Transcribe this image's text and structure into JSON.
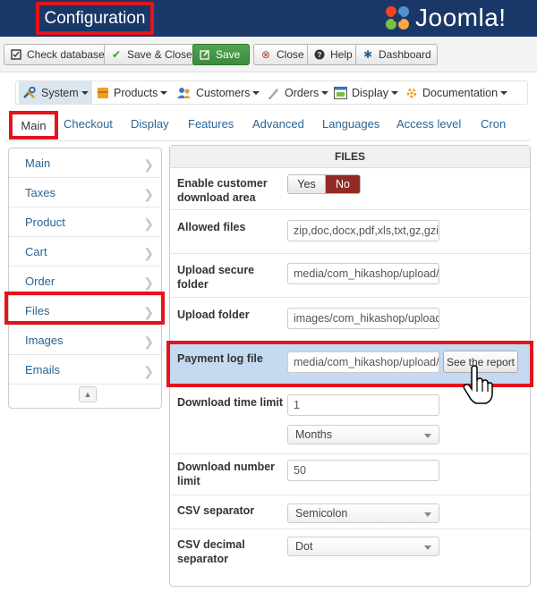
{
  "header": {
    "title": "Configuration",
    "logo_text": "Joomla!"
  },
  "toolbar": [
    {
      "label": "Check database",
      "icon": "wrench-check-icon"
    },
    {
      "label": "Save & Close",
      "icon": "check-icon"
    },
    {
      "label": "Save",
      "icon": "edit-icon"
    },
    {
      "label": "Close",
      "icon": "cancel-icon"
    },
    {
      "label": "Help",
      "icon": "question-icon"
    },
    {
      "label": "Dashboard",
      "icon": "asterisk-icon"
    }
  ],
  "menu": [
    {
      "label": "System",
      "icon": "tools-icon"
    },
    {
      "label": "Products",
      "icon": "products-icon"
    },
    {
      "label": "Customers",
      "icon": "customers-icon"
    },
    {
      "label": "Orders",
      "icon": "orders-icon"
    },
    {
      "label": "Display",
      "icon": "display-icon"
    },
    {
      "label": "Documentation",
      "icon": "documentation-icon"
    }
  ],
  "tabs": [
    "Main",
    "Checkout",
    "Display",
    "Features",
    "Advanced",
    "Languages",
    "Access level",
    "Cron"
  ],
  "sidenav": [
    "Main",
    "Taxes",
    "Product",
    "Cart",
    "Order",
    "Files",
    "Images",
    "Emails"
  ],
  "panel": {
    "title": "FILES",
    "enable_download_label": "Enable customer download area",
    "yes": "Yes",
    "no": "No",
    "allowed_files_label": "Allowed files",
    "allowed_files_value": "zip,doc,docx,pdf,xls,txt,gz,gzi",
    "secure_folder_label": "Upload secure folder",
    "secure_folder_value": "media/com_hikashop/upload/s",
    "upload_folder_label": "Upload folder",
    "upload_folder_value": "images/com_hikashop/upload/",
    "payment_log_label": "Payment log file",
    "payment_log_value": "media/com_hikashop/upload/s",
    "see_report": "See the report",
    "download_time_label": "Download time limit",
    "download_time_value": "1",
    "download_time_unit": "Months",
    "download_number_label": "Download number limit",
    "download_number_value": "50",
    "csv_sep_label": "CSV separator",
    "csv_sep_value": "Semicolon",
    "csv_dec_label": "CSV decimal separator",
    "csv_dec_value": "Dot"
  }
}
